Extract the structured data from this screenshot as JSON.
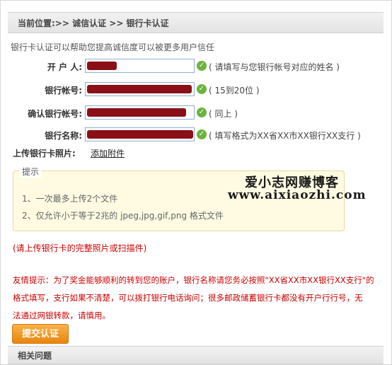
{
  "breadcrumb": "当前位置:>> 诚信认证 >> 银行卡认证",
  "intro": "银行卡认证可以帮助您提高诚信度可以被更多用户信任",
  "fields": [
    {
      "label": "开 户 人:",
      "value": "",
      "hint": "( 请填写与您银行帐号对应的姓名 )"
    },
    {
      "label": "银行帐号:",
      "value": "",
      "hint": "( 15到20位 )"
    },
    {
      "label": "确认银行帐号:",
      "value": "",
      "hint": "( 同上 )"
    },
    {
      "label": "银行名称:",
      "value": "",
      "hint": "( 填写格式为XX省XX市XX银行XX支行 )"
    }
  ],
  "upload": {
    "label": "上传银行卡照片:",
    "link": "添加附件"
  },
  "tip_box": {
    "title": "提示",
    "lines": [
      "1、一次最多上传2个文件",
      "2、仅允许小于等于2兆的 jpeg,jpg,gif,png 格式文件"
    ]
  },
  "watermark": {
    "line1": "爱小志网赚博客",
    "line2": "www.aixiaozhi.com"
  },
  "photo_note": "(请上传银行卡的完整照片或扫描件)",
  "warning": [
    "友情提示：为了奖金能够顺利的转到您的账户，银行名称请您务必按照\"XX省XX市XX银行XX支行\"的",
    "格式填写，支行如果不清楚，可以拨打银行电话询问；很多邮政储蓄银行卡都没有开户行行号，无",
    "法通过网银转款，请慎用。"
  ],
  "submit_label": "提交认证",
  "section2_title": "相关问题"
}
